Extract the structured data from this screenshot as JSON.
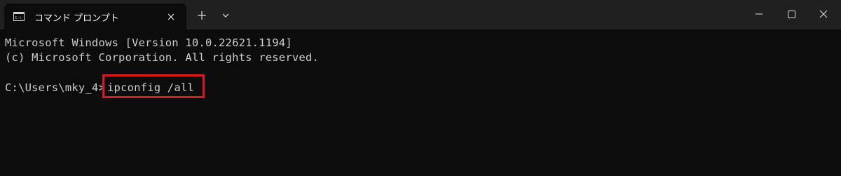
{
  "tab": {
    "icon": "command-prompt-icon",
    "title": "コマンド プロンプト"
  },
  "toolbar": {
    "new_tab_icon": "plus-icon",
    "dropdown_icon": "chevron-down-icon"
  },
  "window_controls": {
    "minimize_icon": "minimize-icon",
    "maximize_icon": "maximize-icon",
    "close_icon": "close-icon"
  },
  "terminal": {
    "line1": "Microsoft Windows [Version 10.0.22621.1194]",
    "line2": "(c) Microsoft Corporation. All rights reserved.",
    "prompt": "C:\\Users\\mky_4>",
    "command": "ipconfig /all"
  },
  "colors": {
    "terminal_bg": "#0c0c0c",
    "titlebar_bg": "#202020",
    "text": "#cccccc",
    "highlight": "#e0141e"
  }
}
